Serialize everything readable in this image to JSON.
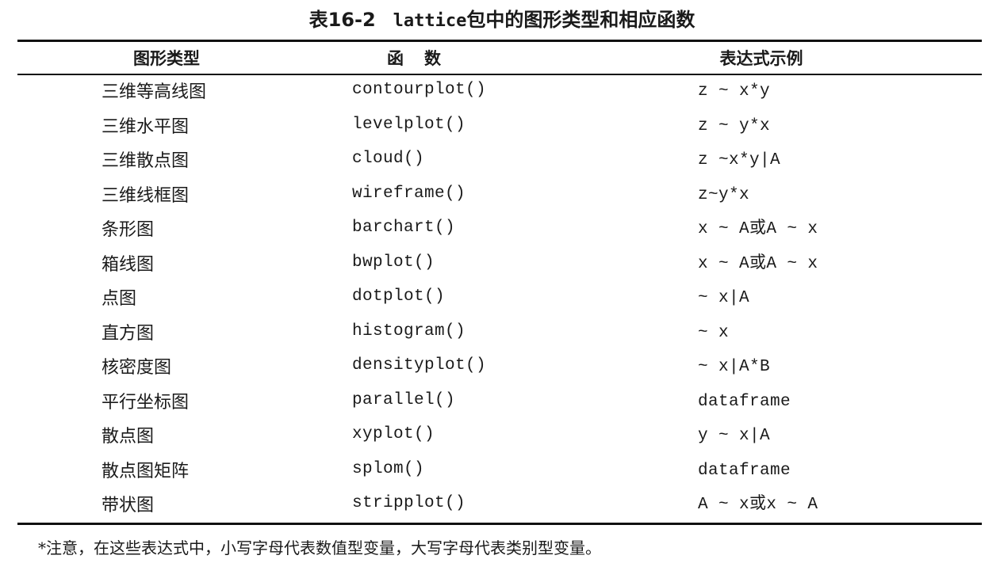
{
  "table": {
    "title_prefix": "表16-2",
    "title_code": "lattice",
    "title_suffix": "包中的图形类型和相应函数",
    "headers": {
      "type": "图形类型",
      "function": "函数",
      "expression": "表达式示例"
    },
    "rows": [
      {
        "type": "三维等高线图",
        "function": "contourplot()",
        "expression": "z ~ x*y"
      },
      {
        "type": "三维水平图",
        "function": "levelplot()",
        "expression": "z ~ y*x"
      },
      {
        "type": "三维散点图",
        "function": "cloud()",
        "expression": "z ~x*y|A"
      },
      {
        "type": "三维线框图",
        "function": "wireframe()",
        "expression": "z~y*x"
      },
      {
        "type": "条形图",
        "function": "barchart()",
        "expression": "x ~ A或A ~ x"
      },
      {
        "type": "箱线图",
        "function": "bwplot()",
        "expression": "x ~ A或A ~ x"
      },
      {
        "type": "点图",
        "function": "dotplot()",
        "expression": "~ x|A"
      },
      {
        "type": "直方图",
        "function": "histogram()",
        "expression": "~ x"
      },
      {
        "type": "核密度图",
        "function": "densityplot()",
        "expression": "~ x|A*B"
      },
      {
        "type": "平行坐标图",
        "function": "parallel()",
        "expression": "dataframe"
      },
      {
        "type": "散点图",
        "function": "xyplot()",
        "expression": "y ~ x|A"
      },
      {
        "type": "散点图矩阵",
        "function": "splom()",
        "expression": "dataframe"
      },
      {
        "type": "带状图",
        "function": "stripplot()",
        "expression": "A ~ x或x ~ A"
      }
    ],
    "footnote": "*注意，在这些表达式中，小写字母代表数值型变量，大写字母代表类别型变量。"
  }
}
